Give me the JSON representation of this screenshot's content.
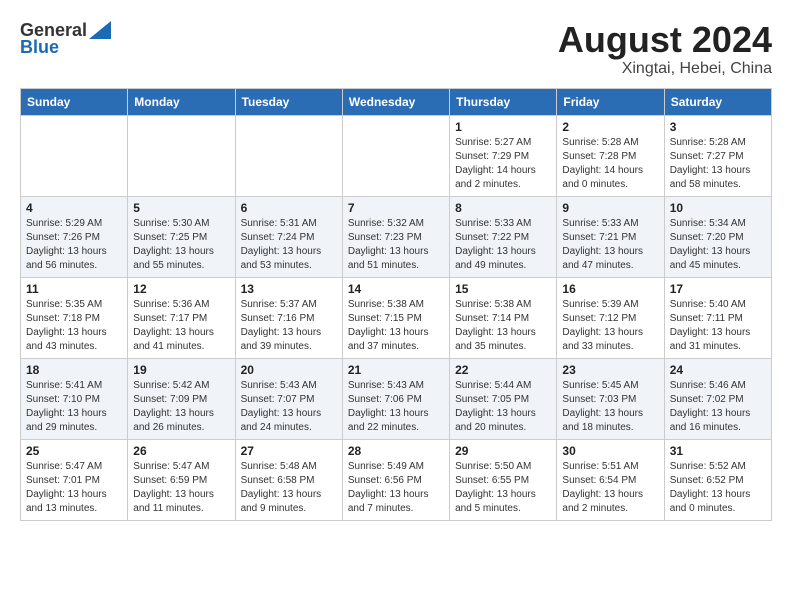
{
  "header": {
    "logo_general": "General",
    "logo_blue": "Blue",
    "title": "August 2024",
    "location": "Xingtai, Hebei, China"
  },
  "weekdays": [
    "Sunday",
    "Monday",
    "Tuesday",
    "Wednesday",
    "Thursday",
    "Friday",
    "Saturday"
  ],
  "weeks": [
    [
      {
        "day": "",
        "detail": ""
      },
      {
        "day": "",
        "detail": ""
      },
      {
        "day": "",
        "detail": ""
      },
      {
        "day": "",
        "detail": ""
      },
      {
        "day": "1",
        "detail": "Sunrise: 5:27 AM\nSunset: 7:29 PM\nDaylight: 14 hours\nand 2 minutes."
      },
      {
        "day": "2",
        "detail": "Sunrise: 5:28 AM\nSunset: 7:28 PM\nDaylight: 14 hours\nand 0 minutes."
      },
      {
        "day": "3",
        "detail": "Sunrise: 5:28 AM\nSunset: 7:27 PM\nDaylight: 13 hours\nand 58 minutes."
      }
    ],
    [
      {
        "day": "4",
        "detail": "Sunrise: 5:29 AM\nSunset: 7:26 PM\nDaylight: 13 hours\nand 56 minutes."
      },
      {
        "day": "5",
        "detail": "Sunrise: 5:30 AM\nSunset: 7:25 PM\nDaylight: 13 hours\nand 55 minutes."
      },
      {
        "day": "6",
        "detail": "Sunrise: 5:31 AM\nSunset: 7:24 PM\nDaylight: 13 hours\nand 53 minutes."
      },
      {
        "day": "7",
        "detail": "Sunrise: 5:32 AM\nSunset: 7:23 PM\nDaylight: 13 hours\nand 51 minutes."
      },
      {
        "day": "8",
        "detail": "Sunrise: 5:33 AM\nSunset: 7:22 PM\nDaylight: 13 hours\nand 49 minutes."
      },
      {
        "day": "9",
        "detail": "Sunrise: 5:33 AM\nSunset: 7:21 PM\nDaylight: 13 hours\nand 47 minutes."
      },
      {
        "day": "10",
        "detail": "Sunrise: 5:34 AM\nSunset: 7:20 PM\nDaylight: 13 hours\nand 45 minutes."
      }
    ],
    [
      {
        "day": "11",
        "detail": "Sunrise: 5:35 AM\nSunset: 7:18 PM\nDaylight: 13 hours\nand 43 minutes."
      },
      {
        "day": "12",
        "detail": "Sunrise: 5:36 AM\nSunset: 7:17 PM\nDaylight: 13 hours\nand 41 minutes."
      },
      {
        "day": "13",
        "detail": "Sunrise: 5:37 AM\nSunset: 7:16 PM\nDaylight: 13 hours\nand 39 minutes."
      },
      {
        "day": "14",
        "detail": "Sunrise: 5:38 AM\nSunset: 7:15 PM\nDaylight: 13 hours\nand 37 minutes."
      },
      {
        "day": "15",
        "detail": "Sunrise: 5:38 AM\nSunset: 7:14 PM\nDaylight: 13 hours\nand 35 minutes."
      },
      {
        "day": "16",
        "detail": "Sunrise: 5:39 AM\nSunset: 7:12 PM\nDaylight: 13 hours\nand 33 minutes."
      },
      {
        "day": "17",
        "detail": "Sunrise: 5:40 AM\nSunset: 7:11 PM\nDaylight: 13 hours\nand 31 minutes."
      }
    ],
    [
      {
        "day": "18",
        "detail": "Sunrise: 5:41 AM\nSunset: 7:10 PM\nDaylight: 13 hours\nand 29 minutes."
      },
      {
        "day": "19",
        "detail": "Sunrise: 5:42 AM\nSunset: 7:09 PM\nDaylight: 13 hours\nand 26 minutes."
      },
      {
        "day": "20",
        "detail": "Sunrise: 5:43 AM\nSunset: 7:07 PM\nDaylight: 13 hours\nand 24 minutes."
      },
      {
        "day": "21",
        "detail": "Sunrise: 5:43 AM\nSunset: 7:06 PM\nDaylight: 13 hours\nand 22 minutes."
      },
      {
        "day": "22",
        "detail": "Sunrise: 5:44 AM\nSunset: 7:05 PM\nDaylight: 13 hours\nand 20 minutes."
      },
      {
        "day": "23",
        "detail": "Sunrise: 5:45 AM\nSunset: 7:03 PM\nDaylight: 13 hours\nand 18 minutes."
      },
      {
        "day": "24",
        "detail": "Sunrise: 5:46 AM\nSunset: 7:02 PM\nDaylight: 13 hours\nand 16 minutes."
      }
    ],
    [
      {
        "day": "25",
        "detail": "Sunrise: 5:47 AM\nSunset: 7:01 PM\nDaylight: 13 hours\nand 13 minutes."
      },
      {
        "day": "26",
        "detail": "Sunrise: 5:47 AM\nSunset: 6:59 PM\nDaylight: 13 hours\nand 11 minutes."
      },
      {
        "day": "27",
        "detail": "Sunrise: 5:48 AM\nSunset: 6:58 PM\nDaylight: 13 hours\nand 9 minutes."
      },
      {
        "day": "28",
        "detail": "Sunrise: 5:49 AM\nSunset: 6:56 PM\nDaylight: 13 hours\nand 7 minutes."
      },
      {
        "day": "29",
        "detail": "Sunrise: 5:50 AM\nSunset: 6:55 PM\nDaylight: 13 hours\nand 5 minutes."
      },
      {
        "day": "30",
        "detail": "Sunrise: 5:51 AM\nSunset: 6:54 PM\nDaylight: 13 hours\nand 2 minutes."
      },
      {
        "day": "31",
        "detail": "Sunrise: 5:52 AM\nSunset: 6:52 PM\nDaylight: 13 hours\nand 0 minutes."
      }
    ]
  ]
}
